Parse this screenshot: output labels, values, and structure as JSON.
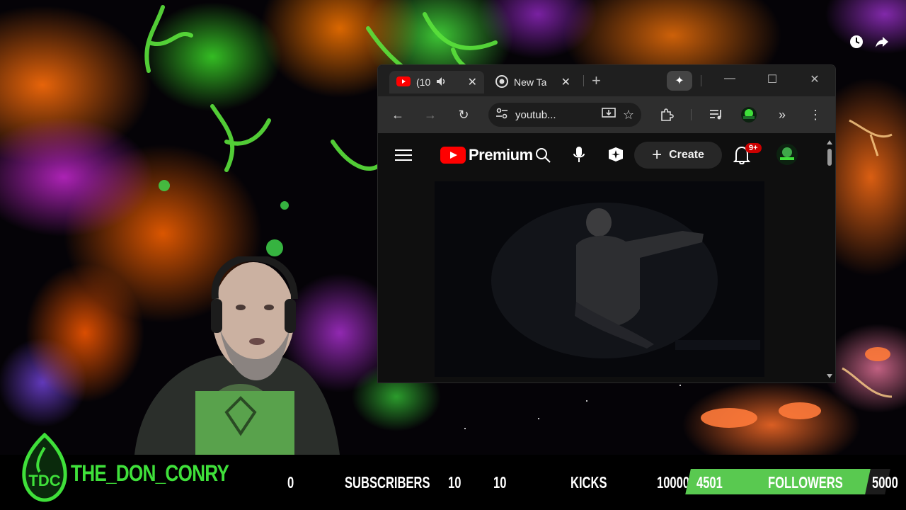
{
  "browser": {
    "tabs": [
      {
        "label": "(10",
        "active": true
      },
      {
        "label": "New Ta",
        "active": false
      }
    ],
    "omnibox": {
      "url": "youtub..."
    }
  },
  "youtube": {
    "logo_text": "Premium",
    "create_label": "Create",
    "notification_badge": "9+"
  },
  "stream": {
    "channel_name": "THE_DON_CONRY",
    "logo_initials": "TDC",
    "stats": {
      "subs_current": "0",
      "subs_label": "SUBSCRIBERS",
      "subs_goal": "10",
      "kicks_current": "10",
      "kicks_label": "KICKS",
      "kicks_goal": "10000",
      "followers_current": "4501",
      "followers_label": "FOLLOWERS",
      "followers_goal": "5000",
      "followers_progress": 0.9
    }
  },
  "colors": {
    "accent_green": "#3fe03a",
    "youtube_red": "#ff0000",
    "progress_fill": "#59c950"
  }
}
